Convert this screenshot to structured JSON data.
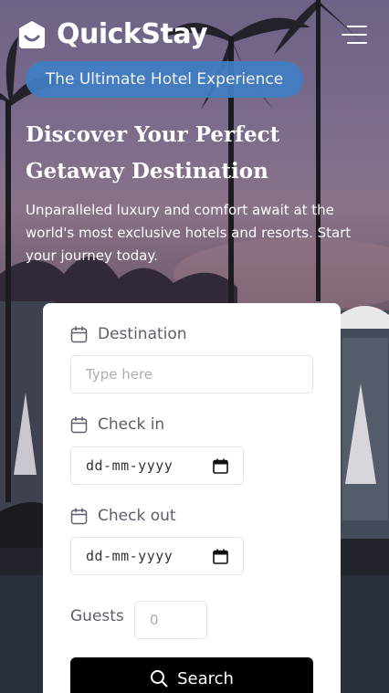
{
  "brand": {
    "name": "QuickStay"
  },
  "hero": {
    "tagline": "The Ultimate Hotel Experience",
    "title_line1": "Discover Your Perfect",
    "title_line2": "Getaway Destination",
    "subtitle_line1": "Unparalleled luxury and comfort await at the",
    "subtitle_line2": "world's most exclusive hotels and resorts. Start",
    "subtitle_line3": "your journey today."
  },
  "form": {
    "destination": {
      "label": "Destination",
      "placeholder": "Type here",
      "icon": "calendar-icon"
    },
    "checkin": {
      "label": "Check in",
      "value": "dd-mm-yyyy",
      "icon": "calendar-icon"
    },
    "checkout": {
      "label": "Check out",
      "value": "dd-mm-yyyy",
      "icon": "calendar-icon"
    },
    "guests": {
      "label": "Guests",
      "placeholder": "0"
    },
    "search": {
      "label": "Search",
      "icon": "search-icon"
    }
  },
  "colors": {
    "tagline_bg": "#3f7fc4",
    "button_bg": "#000000",
    "card_bg": "#ffffff"
  }
}
